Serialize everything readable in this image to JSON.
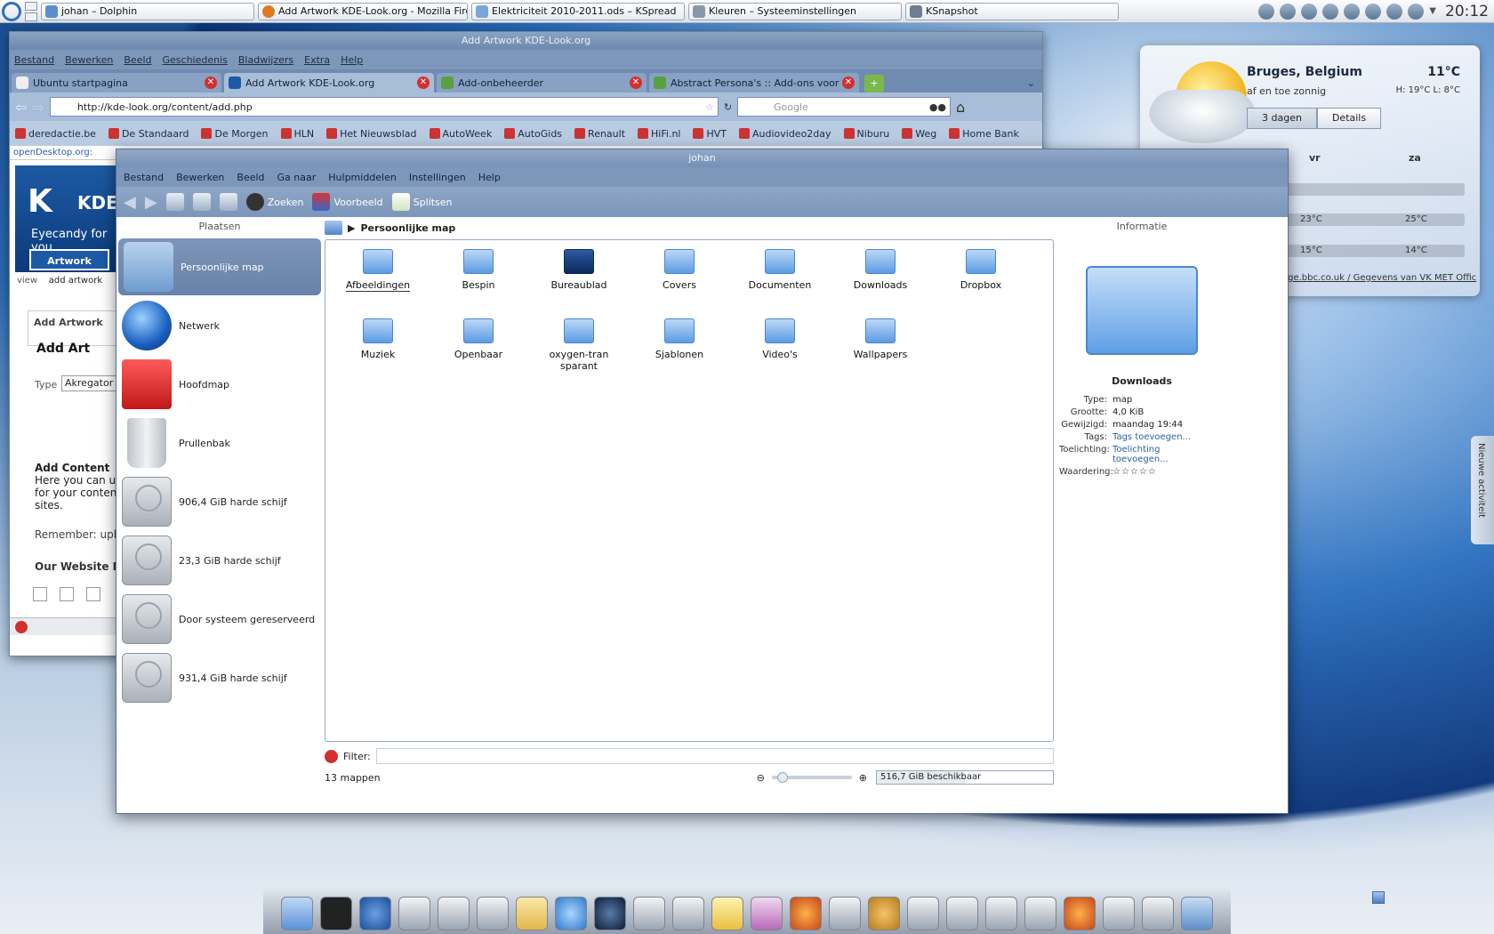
{
  "panel": {
    "tasks": [
      "johan – Dolphin",
      "Add  Artwork KDE-Look.org - Mozilla Firef",
      "Elektriciteit 2010-2011.ods – KSpread",
      "Kleuren – Systeeminstellingen",
      "KSnapshot"
    ],
    "clock": "20:12"
  },
  "firefox": {
    "title": "Add  Artwork KDE-Look.org",
    "menu": [
      "Bestand",
      "Bewerken",
      "Beeld",
      "Geschiedenis",
      "Bladwijzers",
      "Extra",
      "Help"
    ],
    "tabs": [
      {
        "label": "Ubuntu startpagina"
      },
      {
        "label": "Add  Artwork KDE-Look.org"
      },
      {
        "label": "Add-onbeheerder"
      },
      {
        "label": "Abstract Persona's :: Add-ons voor Fir..."
      }
    ],
    "url": "http://kde-look.org/content/add.php",
    "search_placeholder": "Google",
    "bookmarks": [
      "deredactie.be",
      "De Standaard",
      "De Morgen",
      "HLN",
      "Het Nieuwsblad",
      "AutoWeek",
      "AutoGids",
      "Renault",
      "HiFi.nl",
      "HVT",
      "Audiovideo2day",
      "Niburu",
      "Weg",
      "Home Bank"
    ],
    "page": {
      "top_link": "openDesktop.org:",
      "banner_kde": "KDE",
      "banner_tagline": "Eyecandy for you",
      "tab_artwork": "Artwork",
      "sub_view": "view",
      "sub_add": "add artwork",
      "box_title": "Add  Artwork",
      "add_heading": "Add  Art",
      "type_label": "Type",
      "type_value": "Akregator T",
      "add_content_title": "Add Content",
      "add_content_text": "Here you can upl for your content. sites.",
      "remember": "Remember: uplo",
      "our_website": "Our Website N"
    }
  },
  "weather": {
    "city": "Bruges, Belgium",
    "temp": "11°C",
    "condition": "af en toe zonnig",
    "hilo": "H: 19°C L: 8°C",
    "btn_days": "3 dagen",
    "btn_details": "Details",
    "days": [
      "vr",
      "za"
    ],
    "highs": [
      "23°C",
      "25°C"
    ],
    "lows": [
      "15°C",
      "14°C"
    ],
    "credit": "age.bbc.co.uk / Gegevens van VK MET Offic"
  },
  "side_tab": "Nieuwe activiteit",
  "dolphin": {
    "title": "johan",
    "menu": [
      "Bestand",
      "Bewerken",
      "Beeld",
      "Ga naar",
      "Hulpmiddelen",
      "Instellingen",
      "Help"
    ],
    "toolbar": {
      "search": "Zoeken",
      "preview": "Voorbeeld",
      "split": "Splitsen"
    },
    "places_header": "Plaatsen",
    "places": [
      "Persoonlijke map",
      "Netwerk",
      "Hoofdmap",
      "Prullenbak",
      "906,4 GiB harde schijf",
      "23,3 GiB harde schijf",
      "Door systeem gereserveerd",
      "931,4 GiB harde schijf"
    ],
    "breadcrumb": "Persoonlijke map",
    "files": [
      "Afbeeldingen",
      "Bespin",
      "Bureaublad",
      "Covers",
      "Documenten",
      "Downloads",
      "Dropbox",
      "Muziek",
      "Openbaar",
      "oxygen-transparant",
      "Sjablonen",
      "Video's",
      "Wallpapers"
    ],
    "filter_label": "Filter:",
    "status": "13 mappen",
    "free_space": "516,7 GiB beschikbaar",
    "info": {
      "header": "Informatie",
      "name": "Downloads",
      "rows": [
        {
          "k": "Type:",
          "v": "map"
        },
        {
          "k": "Grootte:",
          "v": "4,0 KiB"
        },
        {
          "k": "Gewijzigd:",
          "v": "maandag 19:44"
        },
        {
          "k": "Tags:",
          "v": "Tags toevoegen..."
        },
        {
          "k": "Toelichting:",
          "v": "Toelichting toevoegen..."
        },
        {
          "k": "Waardering:",
          "v": "☆☆☆☆☆"
        }
      ]
    }
  }
}
